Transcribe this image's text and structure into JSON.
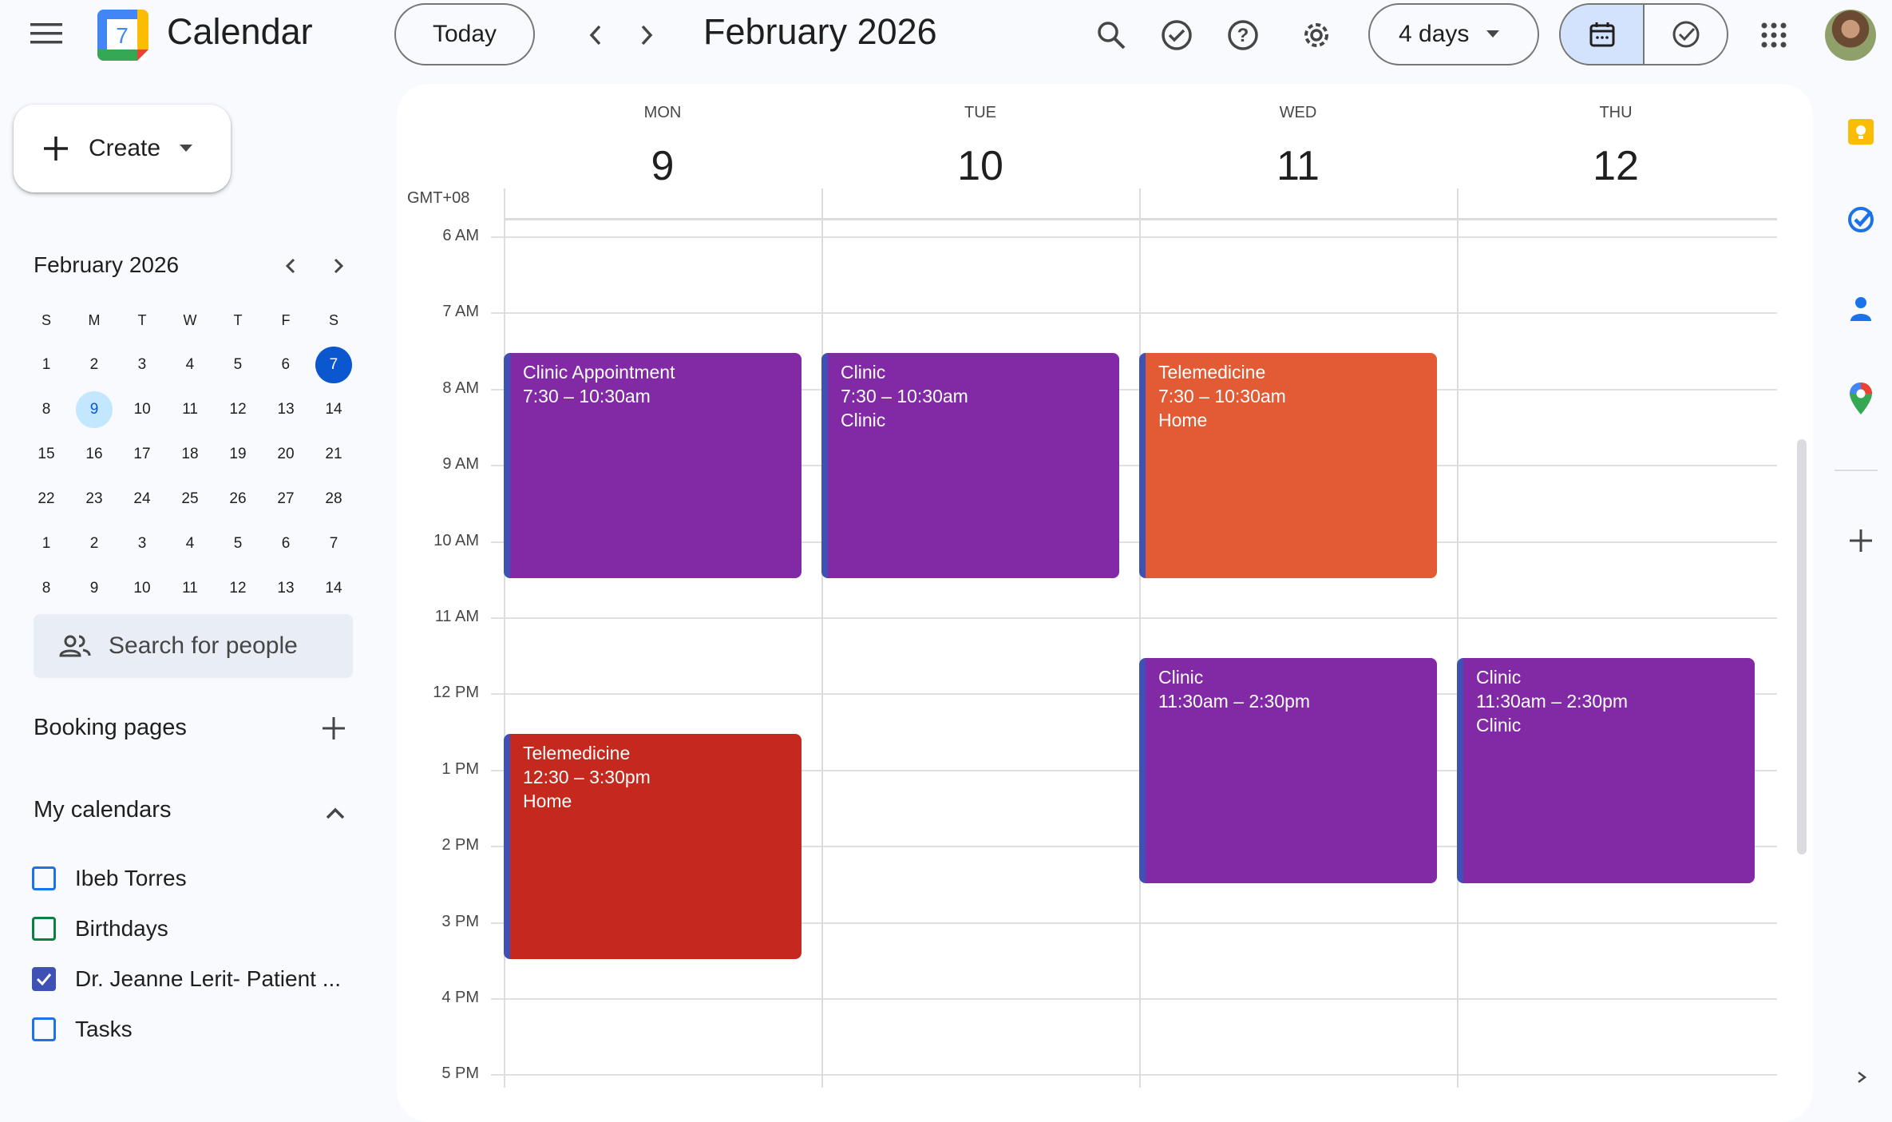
{
  "app": {
    "title": "Calendar",
    "logo_text": "7"
  },
  "header": {
    "today_label": "Today",
    "month_title": "February 2026",
    "view_label": "4 days"
  },
  "create_label": "Create",
  "mini_calendar": {
    "title": "February 2026",
    "weekdays": [
      "S",
      "M",
      "T",
      "W",
      "T",
      "F",
      "S"
    ],
    "weeks": [
      [
        "1",
        "2",
        "3",
        "4",
        "5",
        "6",
        "7"
      ],
      [
        "8",
        "9",
        "10",
        "11",
        "12",
        "13",
        "14"
      ],
      [
        "15",
        "16",
        "17",
        "18",
        "19",
        "20",
        "21"
      ],
      [
        "22",
        "23",
        "24",
        "25",
        "26",
        "27",
        "28"
      ],
      [
        "1",
        "2",
        "3",
        "4",
        "5",
        "6",
        "7"
      ],
      [
        "8",
        "9",
        "10",
        "11",
        "12",
        "13",
        "14"
      ]
    ],
    "selected": "7",
    "current": "9"
  },
  "search_people_placeholder": "Search for people",
  "booking_pages_label": "Booking pages",
  "my_calendars": {
    "label": "My calendars",
    "items": [
      {
        "name": "Ibeb Torres",
        "checked": false,
        "color": "#1a73e8"
      },
      {
        "name": "Birthdays",
        "checked": false,
        "color": "#0b8043"
      },
      {
        "name": "Dr. Jeanne Lerit- Patient ...",
        "checked": true,
        "color": "#3f51b5"
      },
      {
        "name": "Tasks",
        "checked": false,
        "color": "#1a73e8"
      }
    ]
  },
  "grid": {
    "timezone": "GMT+08",
    "days": [
      {
        "name": "MON",
        "num": "9"
      },
      {
        "name": "TUE",
        "num": "10"
      },
      {
        "name": "WED",
        "num": "11"
      },
      {
        "name": "THU",
        "num": "12"
      }
    ],
    "hours": [
      "6 AM",
      "7 AM",
      "8 AM",
      "9 AM",
      "10 AM",
      "11 AM",
      "12 PM",
      "1 PM",
      "2 PM",
      "3 PM",
      "4 PM",
      "5 PM"
    ]
  },
  "events": [
    {
      "title": "Clinic Appointment",
      "time": "7:30 – 10:30am",
      "location": "",
      "day": 0,
      "start": 7.5,
      "end": 10.5,
      "color": "#8229a6"
    },
    {
      "title": "Clinic",
      "time": "7:30 – 10:30am",
      "location": "Clinic",
      "day": 1,
      "start": 7.5,
      "end": 10.5,
      "color": "#8229a6"
    },
    {
      "title": "Telemedicine",
      "time": "7:30 – 10:30am",
      "location": "Home",
      "day": 2,
      "start": 7.5,
      "end": 10.5,
      "color": "#e25b34"
    },
    {
      "title": "Clinic",
      "time": "11:30am – 2:30pm",
      "location": "",
      "day": 2,
      "start": 11.5,
      "end": 14.5,
      "color": "#8229a6"
    },
    {
      "title": "Clinic",
      "time": "11:30am – 2:30pm",
      "location": "Clinic",
      "day": 3,
      "start": 11.5,
      "end": 14.5,
      "color": "#8229a6"
    },
    {
      "title": "Telemedicine",
      "time": "12:30 – 3:30pm",
      "location": "Home",
      "day": 0,
      "start": 12.5,
      "end": 15.5,
      "color": "#c5281c"
    }
  ]
}
